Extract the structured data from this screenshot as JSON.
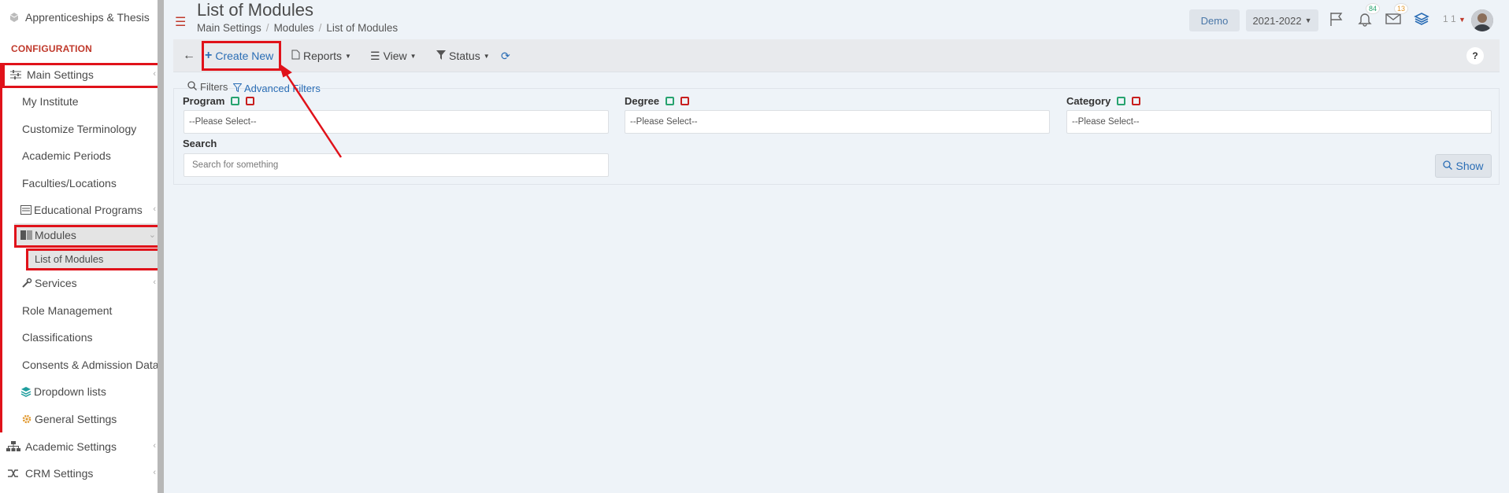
{
  "sidebar": {
    "top_item": "Apprenticeships & Thesis",
    "section": "CONFIGURATION",
    "main_settings": "Main Settings",
    "items": [
      {
        "label": "My Institute"
      },
      {
        "label": "Customize Terminology"
      },
      {
        "label": "Academic Periods"
      },
      {
        "label": "Faculties/Locations"
      },
      {
        "label": "Educational Programs"
      },
      {
        "label": "Modules"
      },
      {
        "label": "List of Modules"
      },
      {
        "label": "Services"
      },
      {
        "label": "Role Management"
      },
      {
        "label": "Classifications"
      },
      {
        "label": "Consents & Admission Data"
      },
      {
        "label": "Dropdown lists"
      },
      {
        "label": "General Settings"
      }
    ],
    "academic_settings": "Academic Settings",
    "crm_settings": "CRM Settings"
  },
  "header": {
    "title": "List of Modules",
    "breadcrumb": [
      "Main Settings",
      "Modules",
      "List of Modules"
    ],
    "demo_label": "Demo",
    "year": "2021-2022",
    "notifications_count": "84",
    "messages_count": "13",
    "user_label": "1 1"
  },
  "toolbar": {
    "create_new": "Create New",
    "reports": "Reports",
    "view": "View",
    "status": "Status",
    "help": "?"
  },
  "filters": {
    "title": "Filters",
    "advanced": "Advanced Filters",
    "program_label": "Program",
    "degree_label": "Degree",
    "category_label": "Category",
    "program_value": "--Please Select--",
    "degree_value": "--Please Select--",
    "category_value": "--Please Select--",
    "search_label": "Search",
    "search_placeholder": "Search for something",
    "show_button": "Show"
  },
  "colors": {
    "accent": "#2a6db5",
    "highlight": "#e0121a",
    "section": "#c0392b"
  }
}
